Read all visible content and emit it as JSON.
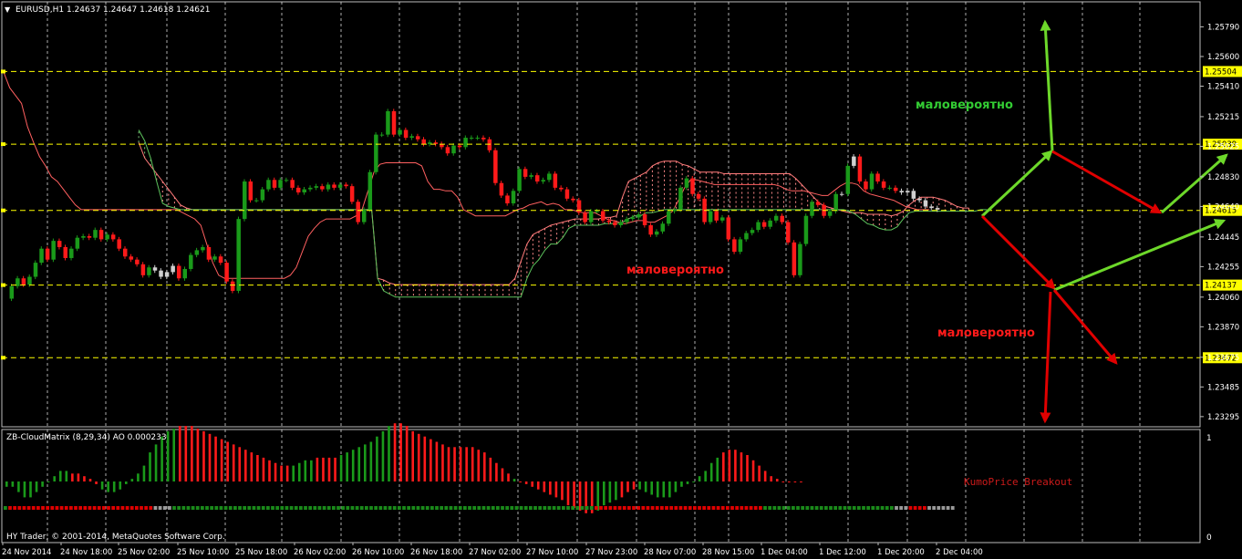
{
  "main_chart": {
    "symbol_header": "EURUSD,H1  1.24637 1.24647 1.24618 1.24621",
    "copyright": "HY Trader, © 2001-2014, MetaQuotes Software Corp.",
    "annotations": [
      {
        "text": "маловероятно",
        "color": "#33cc33"
      },
      {
        "text": "маловероятно",
        "color": "#ff1a1a"
      },
      {
        "text": "маловероятно",
        "color": "#ff1a1a"
      }
    ]
  },
  "indicator": {
    "header": "ZB-CloudMatrix (8,29,34)  AO 0.000233",
    "label": "KumoPrice Breakout",
    "scale_top": "1",
    "scale_bottom": "0"
  },
  "chart_data": {
    "type": "candlestick",
    "title": "EURUSD,H1",
    "ohlc_header": {
      "open": 1.24637,
      "high": 1.24647,
      "low": 1.24618,
      "close": 1.24621
    },
    "y_tick_labels": [
      "1.25790",
      "1.25600",
      "1.25410",
      "1.25215",
      "1.25025",
      "1.24830",
      "1.24640",
      "1.24445",
      "1.24255",
      "1.24060",
      "1.23870",
      "1.23675",
      "1.23485",
      "1.23295"
    ],
    "price_levels": [
      {
        "value": "1.25504",
        "color": "#ffff00"
      },
      {
        "value": "1.25039",
        "color": "#ffff00"
      },
      {
        "value": "1.24615",
        "color": "#ffff00"
      },
      {
        "value": "1.24137",
        "color": "#ffff00"
      },
      {
        "value": "1.23672",
        "color": "#ffff00"
      }
    ],
    "x_tick_labels": [
      "24 Nov 2014",
      "24 Nov 18:00",
      "25 Nov 02:00",
      "25 Nov 10:00",
      "25 Nov 18:00",
      "26 Nov 02:00",
      "26 Nov 10:00",
      "26 Nov 18:00",
      "27 Nov 02:00",
      "27 Nov 10:00",
      "27 Nov 23:00",
      "28 Nov 07:00",
      "28 Nov 15:00",
      "1 Dec 04:00",
      "1 Dec 12:00",
      "1 Dec 20:00",
      "2 Dec 04:00"
    ],
    "ylim": [
      1.2323,
      1.2595
    ],
    "colors": {
      "bull": "#1a9a1a",
      "bear": "#ff1a1a",
      "neutral": "#d0d0d0",
      "grid": "#ffffff",
      "level": "#ffff00"
    },
    "candles_close": [
      1.2405,
      1.2413,
      1.2418,
      1.2414,
      1.2419,
      1.2428,
      1.2437,
      1.243,
      1.2442,
      1.2438,
      1.2431,
      1.2437,
      1.2444,
      1.2445,
      1.2444,
      1.2449,
      1.2443,
      1.2446,
      1.2443,
      1.2437,
      1.2432,
      1.243,
      1.2427,
      1.242,
      1.2425,
      1.2423,
      1.2419,
      1.2422,
      1.2426,
      1.2418,
      1.2424,
      1.2433,
      1.2436,
      1.2438,
      1.243,
      1.2432,
      1.2428,
      1.2416,
      1.241,
      1.2456,
      1.248,
      1.2468,
      1.2468,
      1.2475,
      1.2481,
      1.2476,
      1.2481,
      1.2481,
      1.2476,
      1.2473,
      1.2475,
      1.2476,
      1.2477,
      1.2475,
      1.2478,
      1.2476,
      1.2478,
      1.2477,
      1.2467,
      1.2454,
      1.2462,
      1.2486,
      1.251,
      1.251,
      1.2525,
      1.251,
      1.2513,
      1.2508,
      1.2509,
      1.2507,
      1.2504,
      1.2505,
      1.2504,
      1.2502,
      1.2498,
      1.2503,
      1.2502,
      1.2508,
      1.2508,
      1.2508,
      1.2507,
      1.25,
      1.2479,
      1.2471,
      1.2466,
      1.2474,
      1.2488,
      1.2483,
      1.2484,
      1.248,
      1.2481,
      1.2485,
      1.2476,
      1.2475,
      1.2469,
      1.2468,
      1.246,
      1.2454,
      1.2461,
      1.2461,
      1.2455,
      1.2454,
      1.2452,
      1.2454,
      1.2456,
      1.2457,
      1.2459,
      1.2452,
      1.2446,
      1.2448,
      1.2453,
      1.2461,
      1.2462,
      1.2476,
      1.2482,
      1.2472,
      1.2469,
      1.2454,
      1.2461,
      1.2455,
      1.2457,
      1.2443,
      1.2435,
      1.2443,
      1.2447,
      1.2449,
      1.2454,
      1.2451,
      1.2455,
      1.2458,
      1.2454,
      1.2441,
      1.242,
      1.244,
      1.2458,
      1.2467,
      1.2465,
      1.2458,
      1.2461,
      1.2472,
      1.2472,
      1.249,
      1.2496,
      1.248,
      1.2475,
      1.2485,
      1.248,
      1.2476,
      1.2476,
      1.2474,
      1.2473,
      1.2474,
      1.2469,
      1.2468,
      1.2464,
      1.2463,
      1.2462
    ],
    "tenkan_sen": [
      1.255,
      1.254,
      1.2535,
      1.253,
      1.2515,
      1.2505,
      1.2496,
      1.249,
      1.2483,
      1.248,
      1.2475,
      1.247,
      1.2465,
      1.2462,
      1.2462,
      1.2462,
      1.2462,
      1.2462,
      1.2462,
      1.2462,
      1.2462,
      1.2462,
      1.2462,
      1.2462,
      1.2462,
      1.2462,
      1.2462,
      1.2462,
      1.2462,
      1.2462,
      1.246,
      1.2458,
      1.2456,
      1.2452,
      1.244,
      1.2428,
      1.242,
      1.2418,
      1.2418,
      1.2418,
      1.2418,
      1.2418,
      1.2418,
      1.2418,
      1.2418,
      1.2418,
      1.2418,
      1.2418,
      1.242,
      1.2425,
      1.2435,
      1.2445,
      1.245,
      1.2454,
      1.2456,
      1.2456,
      1.2456,
      1.2456,
      1.2456,
      1.2458,
      1.2462,
      1.2474,
      1.2486,
      1.2491,
      1.2492,
      1.2492,
      1.2492,
      1.2492,
      1.2492,
      1.2492,
      1.249,
      1.248,
      1.2475,
      1.2475,
      1.2474,
      1.2474,
      1.247,
      1.2462,
      1.246,
      1.2458,
      1.2458,
      1.2458,
      1.2458,
      1.2458,
      1.2458,
      1.246,
      1.2462,
      1.2463,
      1.2465,
      1.2466,
      1.2467,
      1.2465,
      1.2466,
      1.2465,
      1.2462,
      1.2462,
      1.2461,
      1.246,
      1.246,
      1.246,
      1.2458,
      1.2456,
      1.2455,
      1.2454,
      1.2453,
      1.2454,
      1.2455,
      1.2455,
      1.2454,
      1.2454,
      1.2456,
      1.2458,
      1.2461,
      1.2468,
      1.2476,
      1.2481,
      1.2481,
      1.248,
      1.2479,
      1.2478,
      1.2478,
      1.2478,
      1.2478,
      1.2478,
      1.2478,
      1.2478,
      1.2478,
      1.2478,
      1.2478,
      1.2478,
      1.2477,
      1.2475,
      1.2474,
      1.2474,
      1.2474,
      1.2473,
      1.2472,
      1.2471,
      1.2471,
      1.2474,
      1.2477,
      1.2479,
      1.2479,
      1.2478,
      1.2474,
      1.2472,
      1.2471,
      1.247,
      1.2469,
      1.2468,
      1.2466,
      1.2464,
      1.2463,
      1.2462,
      1.2462,
      1.2462
    ],
    "span_a": [
      null,
      null,
      null,
      null,
      null,
      null,
      null,
      null,
      null,
      null,
      null,
      null,
      null,
      null,
      null,
      null,
      null,
      null,
      null,
      null,
      null,
      null,
      1.2505,
      1.2495,
      1.249,
      1.2485,
      1.248,
      1.2475,
      1.247,
      1.2465,
      1.2463,
      1.2462,
      1.2462,
      1.2462,
      1.2462,
      1.2462,
      1.2462,
      1.2462,
      1.2462,
      1.2462,
      1.2462,
      1.2462,
      1.2462,
      1.2462,
      1.2462,
      1.2462,
      1.2462,
      1.2462,
      1.2462,
      1.2462,
      1.2462,
      1.2462,
      1.2462,
      1.2462,
      1.2462,
      1.2462,
      1.2462,
      1.2462,
      1.2462,
      1.2462,
      1.2462,
      1.2462,
      1.2418,
      1.2417,
      1.2415,
      1.2414,
      1.2414,
      1.2414,
      1.2414,
      1.2414,
      1.2414,
      1.2414,
      1.2414,
      1.2414,
      1.2414,
      1.2414,
      1.2414,
      1.2414,
      1.2414,
      1.2414,
      1.2414,
      1.2414,
      1.2414,
      1.2414,
      1.2414,
      1.2418,
      1.2429,
      1.244,
      1.2446,
      1.2448,
      1.245,
      1.2452,
      1.2453,
      1.2454,
      1.2455,
      1.2456,
      1.2456,
      1.2456,
      1.2456,
      1.2456,
      1.2457,
      1.2457,
      1.2458,
      1.247,
      1.248,
      1.2482,
      1.2484,
      1.2486,
      1.249,
      1.2492,
      1.2493,
      1.2493,
      1.2493,
      1.2491,
      1.249,
      1.2488,
      1.2486,
      1.2486,
      1.2486,
      1.2486,
      1.2485,
      1.2485,
      1.2485,
      1.2485,
      1.2485,
      1.2485,
      1.2485,
      1.2485,
      1.2485,
      1.2485,
      1.2485,
      1.2485,
      1.2482,
      1.2478,
      1.2474,
      1.247,
      1.2466,
      1.2464,
      1.2463,
      1.2462,
      1.2461,
      1.246,
      1.246,
      1.246,
      1.2459,
      1.2459,
      1.2459,
      1.2459,
      1.2458,
      1.2459,
      1.2461,
      1.2465,
      1.2468,
      1.247,
      1.247,
      1.247,
      1.2469,
      1.2468,
      1.2466,
      1.2464,
      1.2463,
      1.2463
    ],
    "span_b": [
      null,
      null,
      null,
      null,
      null,
      null,
      null,
      null,
      null,
      null,
      null,
      null,
      null,
      null,
      null,
      null,
      null,
      null,
      null,
      null,
      null,
      null,
      1.2513,
      1.2506,
      1.2495,
      1.248,
      1.2466,
      1.2464,
      1.2463,
      1.2462,
      1.2462,
      1.2462,
      1.2462,
      1.2462,
      1.2462,
      1.2462,
      1.2462,
      1.2462,
      1.2462,
      1.2462,
      1.2462,
      1.2462,
      1.2462,
      1.2462,
      1.2462,
      1.2462,
      1.2462,
      1.2462,
      1.2462,
      1.2462,
      1.2462,
      1.2462,
      1.2462,
      1.2462,
      1.2462,
      1.2462,
      1.2462,
      1.2462,
      1.2462,
      1.2462,
      1.2462,
      1.2462,
      1.2418,
      1.241,
      1.2408,
      1.2406,
      1.2406,
      1.2406,
      1.2406,
      1.2406,
      1.2406,
      1.2406,
      1.2406,
      1.2406,
      1.2406,
      1.2406,
      1.2406,
      1.2406,
      1.2406,
      1.2406,
      1.2406,
      1.2406,
      1.2406,
      1.2406,
      1.2406,
      1.2406,
      1.2406,
      1.2418,
      1.2426,
      1.243,
      1.2436,
      1.244,
      1.244,
      1.2444,
      1.245,
      1.2452,
      1.2452,
      1.2452,
      1.2452,
      1.2452,
      1.2453,
      1.2453,
      1.2453,
      1.2454,
      1.2456,
      1.2458,
      1.2458,
      1.246,
      1.246,
      1.2461,
      1.2462,
      1.2462,
      1.2462,
      1.2462,
      1.2462,
      1.2462,
      1.2462,
      1.2462,
      1.2462,
      1.2462,
      1.2462,
      1.2462,
      1.2462,
      1.2462,
      1.2462,
      1.2462,
      1.2462,
      1.2462,
      1.2462,
      1.2462,
      1.2462,
      1.2462,
      1.2462,
      1.2462,
      1.2462,
      1.2462,
      1.2462,
      1.2462,
      1.2462,
      1.2462,
      1.2462,
      1.2461,
      1.2459,
      1.2456,
      1.2453,
      1.2452,
      1.245,
      1.2449,
      1.2449,
      1.2451,
      1.2456,
      1.246,
      1.2461,
      1.2461,
      1.2461,
      1.2461,
      1.2461,
      1.2461,
      1.2461,
      1.2461,
      1.2461,
      1.2461,
      1.2461,
      1.2462,
      1.2462
    ],
    "histogram_values": [
      -0.0002,
      -0.0002,
      -0.0004,
      -0.0006,
      -0.0006,
      -0.0004,
      -0.0002,
      0.0,
      0.0002,
      0.0004,
      0.0004,
      0.0003,
      0.0003,
      0.0002,
      0.0001,
      -0.0001,
      -0.0003,
      -0.0004,
      -0.0004,
      -0.0003,
      -0.0001,
      0.0001,
      0.0003,
      0.0006,
      0.0011,
      0.0014,
      0.0017,
      0.0019,
      0.002,
      0.0021,
      0.0021,
      0.0021,
      0.002,
      0.0019,
      0.0018,
      0.0017,
      0.0016,
      0.0015,
      0.0014,
      0.0013,
      0.0012,
      0.0011,
      0.001,
      0.0009,
      0.0008,
      0.0007,
      0.0006,
      0.0006,
      0.0006,
      0.0007,
      0.0008,
      0.0008,
      0.0009,
      0.0009,
      0.0009,
      0.0009,
      0.001,
      0.0011,
      0.0012,
      0.0013,
      0.0014,
      0.0015,
      0.0017,
      0.0019,
      0.0021,
      0.0022,
      0.0022,
      0.0021,
      0.0019,
      0.0018,
      0.0017,
      0.0016,
      0.0015,
      0.0014,
      0.0013,
      0.0013,
      0.0013,
      0.0013,
      0.0013,
      0.0012,
      0.0011,
      0.0009,
      0.0007,
      0.0005,
      0.0003,
      0.0001,
      0.0,
      -0.0001,
      -0.0002,
      -0.0003,
      -0.0004,
      -0.0005,
      -0.0006,
      -0.0007,
      -0.0009,
      -0.001,
      -0.0011,
      -0.0012,
      -0.0012,
      -0.0011,
      -0.0009,
      -0.0008,
      -0.0007,
      -0.0006,
      -0.0004,
      -0.0003,
      -0.0003,
      -0.0004,
      -0.0005,
      -0.0006,
      -0.0006,
      -0.0006,
      -0.0004,
      -0.0002,
      -0.0001,
      0.0,
      0.0002,
      0.0004,
      0.0007,
      0.0009,
      0.0011,
      0.0012,
      0.0012,
      0.0011,
      0.001,
      0.0008,
      0.0006,
      0.0004,
      0.0002,
      0.0001,
      0.0,
      0.0,
      0.0,
      0.0
    ],
    "histogram_colors": [
      "g",
      "g",
      "g",
      "g",
      "g",
      "g",
      "g",
      "g",
      "g",
      "g",
      "g",
      "r",
      "r",
      "r",
      "r",
      "r",
      "g",
      "g",
      "g",
      "g",
      "g",
      "g",
      "g",
      "g",
      "g",
      "g",
      "g",
      "g",
      "g",
      "r",
      "r",
      "r",
      "r",
      "r",
      "r",
      "r",
      "r",
      "r",
      "r",
      "r",
      "r",
      "r",
      "r",
      "r",
      "r",
      "r",
      "r",
      "r",
      "g",
      "g",
      "g",
      "g",
      "r",
      "r",
      "r",
      "r",
      "g",
      "g",
      "g",
      "g",
      "g",
      "g",
      "g",
      "g",
      "g",
      "r",
      "r",
      "r",
      "r",
      "r",
      "r",
      "r",
      "r",
      "r",
      "r",
      "r",
      "r",
      "r",
      "r",
      "r",
      "r",
      "r",
      "r",
      "r",
      "r",
      "g",
      "r",
      "r",
      "r",
      "r",
      "r",
      "r",
      "r",
      "r",
      "r",
      "r",
      "r",
      "r",
      "r",
      "g",
      "g",
      "g",
      "g",
      "r",
      "r",
      "r",
      "g",
      "g",
      "g",
      "g",
      "g",
      "g",
      "g",
      "g",
      "g",
      "g",
      "g",
      "g",
      "g",
      "g",
      "r",
      "r",
      "r",
      "r",
      "r",
      "r",
      "r",
      "r",
      "r",
      "r",
      "r",
      "r",
      "r",
      "r",
      "r"
    ],
    "signal_strip": [
      "g",
      "r",
      "r",
      "r",
      "r",
      "r",
      "r",
      "r",
      "r",
      "r",
      "r",
      "r",
      "r",
      "r",
      "r",
      "r",
      "r",
      "r",
      "r",
      "r",
      "r",
      "r",
      "r",
      "r",
      "r",
      "r",
      "r",
      "r",
      "r",
      "r",
      "r",
      "r",
      "n",
      "n",
      "n",
      "n",
      "g",
      "g",
      "g",
      "g",
      "g",
      "g",
      "g",
      "g",
      "g",
      "g",
      "g",
      "g",
      "g",
      "g",
      "g",
      "g",
      "g",
      "g",
      "g",
      "g",
      "g",
      "g",
      "g",
      "g",
      "g",
      "g",
      "g",
      "g",
      "g",
      "g",
      "g",
      "g",
      "g",
      "g",
      "g",
      "g",
      "g",
      "g",
      "g",
      "g",
      "g",
      "g",
      "g",
      "g",
      "g",
      "g",
      "g",
      "g",
      "g",
      "g",
      "g",
      "g",
      "g",
      "g",
      "g",
      "g",
      "g",
      "g",
      "g",
      "g",
      "g",
      "g",
      "g",
      "g",
      "g",
      "g",
      "g",
      "g",
      "g",
      "g",
      "g",
      "g",
      "g",
      "g",
      "g",
      "g",
      "g",
      "g",
      "g",
      "g",
      "g",
      "g",
      "g",
      "g",
      "g",
      "g",
      "g",
      "g",
      "g",
      "g",
      "r",
      "r",
      "r",
      "r",
      "r",
      "r",
      "r",
      "r",
      "r",
      "r",
      "r",
      "r",
      "r",
      "r",
      "r",
      "r",
      "r",
      "r",
      "r",
      "r",
      "r",
      "r",
      "r",
      "r",
      "r",
      "r",
      "r",
      "r",
      "r",
      "r",
      "r",
      "r",
      "r",
      "r",
      "r",
      "r",
      "g",
      "g",
      "g",
      "g",
      "g",
      "g",
      "g",
      "g",
      "g",
      "g",
      "g",
      "g",
      "g",
      "g",
      "g",
      "g",
      "g",
      "g",
      "g",
      "g",
      "g",
      "g",
      "g",
      "g",
      "g",
      "g",
      "g",
      "g",
      "n",
      "n",
      "n",
      "r",
      "r",
      "r",
      "r",
      "n",
      "n",
      "n",
      "n",
      "n",
      "n"
    ]
  }
}
